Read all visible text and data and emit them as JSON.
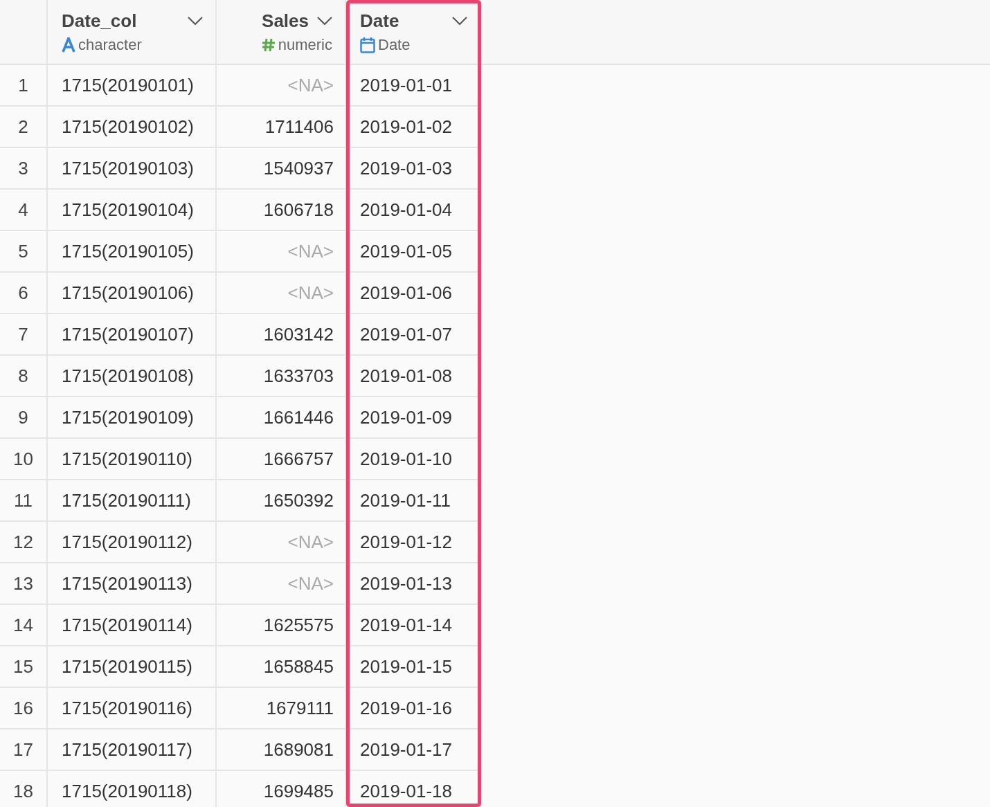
{
  "columns": [
    {
      "name": "Date_col",
      "type": "character",
      "kind": "character",
      "highlighted": false
    },
    {
      "name": "Sales",
      "type": "numeric",
      "kind": "numeric",
      "highlighted": false
    },
    {
      "name": "Date",
      "type": "Date",
      "kind": "date",
      "highlighted": true
    }
  ],
  "rows": [
    {
      "num": "1",
      "date_col": "1715(20190101)",
      "sales": "<NA>",
      "sales_missing": true,
      "date": "2019-01-01"
    },
    {
      "num": "2",
      "date_col": "1715(20190102)",
      "sales": "1711406",
      "sales_missing": false,
      "date": "2019-01-02"
    },
    {
      "num": "3",
      "date_col": "1715(20190103)",
      "sales": "1540937",
      "sales_missing": false,
      "date": "2019-01-03"
    },
    {
      "num": "4",
      "date_col": "1715(20190104)",
      "sales": "1606718",
      "sales_missing": false,
      "date": "2019-01-04"
    },
    {
      "num": "5",
      "date_col": "1715(20190105)",
      "sales": "<NA>",
      "sales_missing": true,
      "date": "2019-01-05"
    },
    {
      "num": "6",
      "date_col": "1715(20190106)",
      "sales": "<NA>",
      "sales_missing": true,
      "date": "2019-01-06"
    },
    {
      "num": "7",
      "date_col": "1715(20190107)",
      "sales": "1603142",
      "sales_missing": false,
      "date": "2019-01-07"
    },
    {
      "num": "8",
      "date_col": "1715(20190108)",
      "sales": "1633703",
      "sales_missing": false,
      "date": "2019-01-08"
    },
    {
      "num": "9",
      "date_col": "1715(20190109)",
      "sales": "1661446",
      "sales_missing": false,
      "date": "2019-01-09"
    },
    {
      "num": "10",
      "date_col": "1715(20190110)",
      "sales": "1666757",
      "sales_missing": false,
      "date": "2019-01-10"
    },
    {
      "num": "11",
      "date_col": "1715(20190111)",
      "sales": "1650392",
      "sales_missing": false,
      "date": "2019-01-11"
    },
    {
      "num": "12",
      "date_col": "1715(20190112)",
      "sales": "<NA>",
      "sales_missing": true,
      "date": "2019-01-12"
    },
    {
      "num": "13",
      "date_col": "1715(20190113)",
      "sales": "<NA>",
      "sales_missing": true,
      "date": "2019-01-13"
    },
    {
      "num": "14",
      "date_col": "1715(20190114)",
      "sales": "1625575",
      "sales_missing": false,
      "date": "2019-01-14"
    },
    {
      "num": "15",
      "date_col": "1715(20190115)",
      "sales": "1658845",
      "sales_missing": false,
      "date": "2019-01-15"
    },
    {
      "num": "16",
      "date_col": "1715(20190116)",
      "sales": "1679111",
      "sales_missing": false,
      "date": "2019-01-16"
    },
    {
      "num": "17",
      "date_col": "1715(20190117)",
      "sales": "1689081",
      "sales_missing": false,
      "date": "2019-01-17"
    },
    {
      "num": "18",
      "date_col": "1715(20190118)",
      "sales": "1699485",
      "sales_missing": false,
      "date": "2019-01-18"
    }
  ]
}
